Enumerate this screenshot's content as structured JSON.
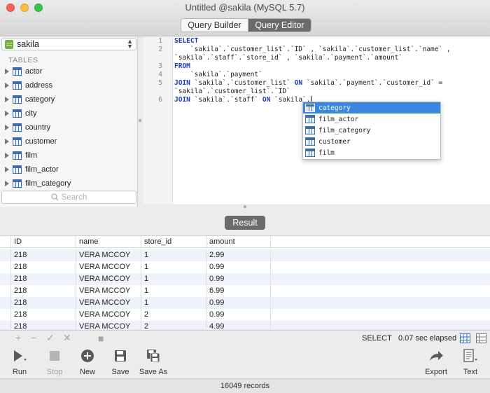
{
  "window": {
    "title": "Untitled @sakila (MySQL 5.7)",
    "segments": [
      "Query Builder",
      "Query Editor"
    ],
    "active_segment": "Query Editor"
  },
  "sidebar": {
    "database": "sakila",
    "section_title": "TABLES",
    "tables": [
      "actor",
      "address",
      "category",
      "city",
      "country",
      "customer",
      "film",
      "film_actor",
      "film_category"
    ],
    "search_placeholder": "Search"
  },
  "editor": {
    "line_numbers": [
      "1",
      "2",
      "3",
      "4",
      "5",
      "6"
    ],
    "lines": [
      {
        "kw": "SELECT",
        "text": ""
      },
      {
        "kw": "",
        "text": "    `sakila`.`customer_list`.`ID` , `sakila`.`customer_list`.`name` ,"
      },
      {
        "kw": "",
        "text": "`sakila`.`staff`.`store_id` , `sakila`.`payment`.`amount`"
      },
      {
        "kw": "FROM",
        "text": ""
      },
      {
        "kw": "",
        "text": "    `sakila`.`payment`"
      },
      {
        "kw": "JOIN",
        "text": " `sakila`.`customer_list` ",
        "kw2": "ON",
        "text2": " `sakila`.`payment`.`customer_id` ="
      },
      {
        "kw": "",
        "text": "`sakila`.`customer_list`.`ID`"
      },
      {
        "kw": "JOIN",
        "text": " `sakila`.`staff` ",
        "kw2": "ON",
        "text2": " `sakila`."
      }
    ],
    "autocomplete": [
      "category",
      "film_actor",
      "film_category",
      "customer",
      "film"
    ],
    "autocomplete_selected": "category"
  },
  "result": {
    "button_label": "Result",
    "columns": [
      "ID",
      "name",
      "store_id",
      "amount"
    ],
    "rows": [
      [
        "218",
        "VERA MCCOY",
        "1",
        "2.99"
      ],
      [
        "218",
        "VERA MCCOY",
        "1",
        "0.99"
      ],
      [
        "218",
        "VERA MCCOY",
        "1",
        "0.99"
      ],
      [
        "218",
        "VERA MCCOY",
        "1",
        "6.99"
      ],
      [
        "218",
        "VERA MCCOY",
        "1",
        "0.99"
      ],
      [
        "218",
        "VERA MCCOY",
        "2",
        "0.99"
      ],
      [
        "218",
        "VERA MCCOY",
        "2",
        "4.99"
      ]
    ]
  },
  "status": {
    "query_type": "SELECT",
    "elapsed": "0.07 sec elapsed"
  },
  "toolbar": {
    "run": "Run",
    "stop": "Stop",
    "new": "New",
    "save": "Save",
    "save_as": "Save As",
    "export": "Export",
    "text": "Text"
  },
  "footer": {
    "records": "16049 records"
  }
}
